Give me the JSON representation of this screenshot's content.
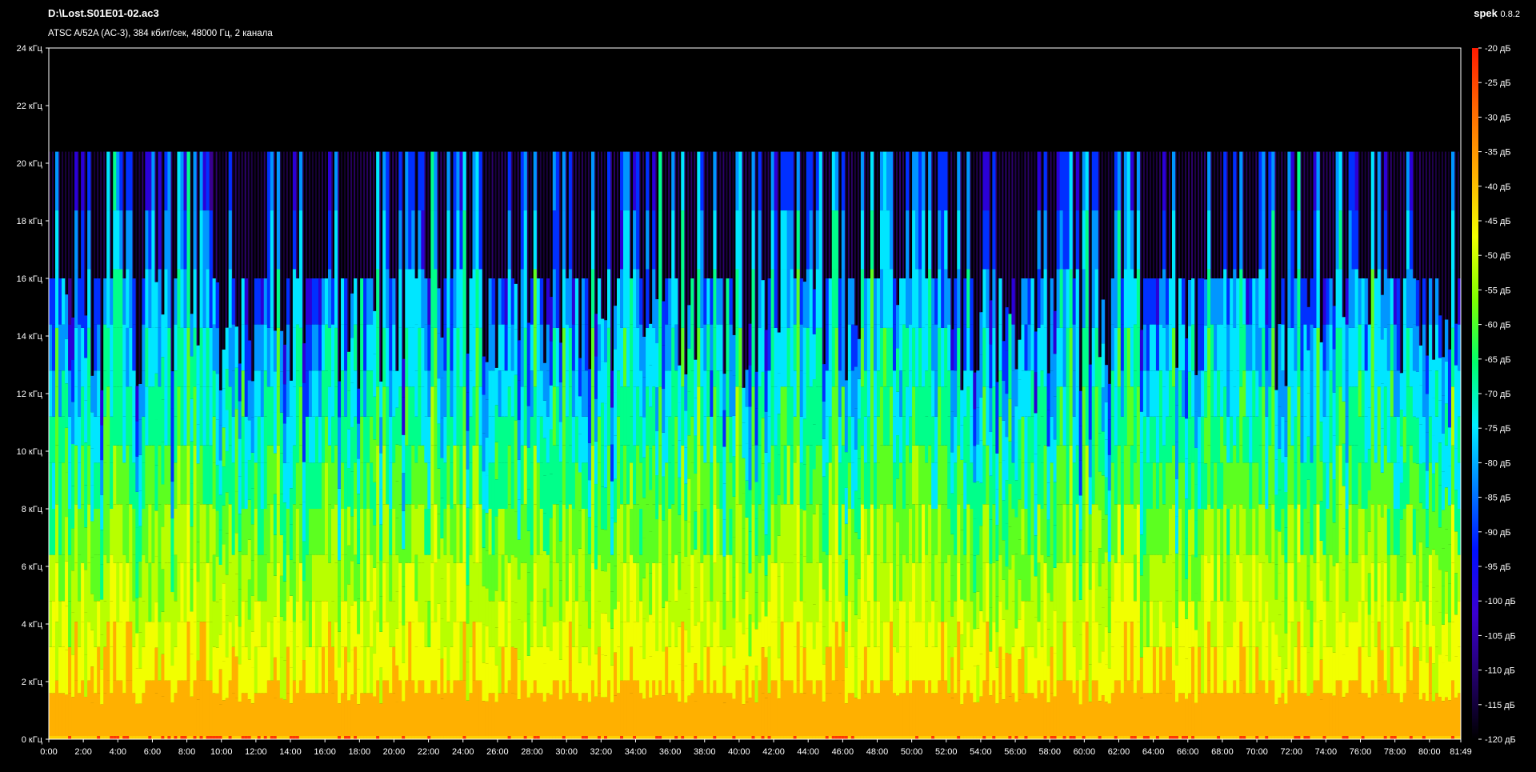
{
  "header": {
    "file_name": "D:\\Lost.S01E01-02.ac3",
    "stream_info": "ATSC A/52A (AC-3), 384 кбит/сек, 48000 Гц, 2 канала",
    "app_name": "spek",
    "app_version": "0.8.2"
  },
  "chart_data": {
    "type": "heatmap",
    "title": "D:\\Lost.S01E01-02.ac3",
    "subtitle": "ATSC A/52A (AC-3), 384 кбит/сек, 48000 Гц, 2 канала",
    "x_axis": {
      "unit": "time (min:sec)",
      "range": [
        "0:00",
        "81:49"
      ],
      "ticks": [
        "0:00",
        "2:00",
        "4:00",
        "6:00",
        "8:00",
        "10:00",
        "12:00",
        "14:00",
        "16:00",
        "18:00",
        "20:00",
        "22:00",
        "24:00",
        "26:00",
        "28:00",
        "30:00",
        "32:00",
        "34:00",
        "36:00",
        "38:00",
        "40:00",
        "42:00",
        "44:00",
        "46:00",
        "48:00",
        "50:00",
        "52:00",
        "54:00",
        "56:00",
        "58:00",
        "60:00",
        "62:00",
        "64:00",
        "66:00",
        "68:00",
        "70:00",
        "72:00",
        "74:00",
        "76:00",
        "78:00",
        "80:00",
        "81:49"
      ]
    },
    "y_axis": {
      "range_khz": [
        0,
        24
      ],
      "ticks": [
        "0 кГц",
        "2 кГц",
        "4 кГц",
        "6 кГц",
        "8 кГц",
        "10 кГц",
        "12 кГц",
        "14 кГц",
        "16 кГц",
        "18 кГц",
        "20 кГц",
        "22 кГц",
        "24 кГц"
      ]
    },
    "color_scale": {
      "range_db": [
        -120,
        -20
      ],
      "ticks": [
        "-20 дБ",
        "-25 дБ",
        "-30 дБ",
        "-35 дБ",
        "-40 дБ",
        "-45 дБ",
        "-50 дБ",
        "-55 дБ",
        "-60 дБ",
        "-65 дБ",
        "-70 дБ",
        "-75 дБ",
        "-80 дБ",
        "-85 дБ",
        "-90 дБ",
        "-95 дБ",
        "-100 дБ",
        "-105 дБ",
        "-110 дБ",
        "-115 дБ",
        "-120 дБ"
      ],
      "colors": [
        "#ff1a00",
        "#ff6a00",
        "#ffb000",
        "#f2ff00",
        "#7dff00",
        "#00ff6a",
        "#00f0ff",
        "#0080ff",
        "#0010ff",
        "#3a00cf",
        "#22006a",
        "#000000"
      ]
    },
    "cutoff_khz": 20.4,
    "lowpass_khz": 16
  }
}
